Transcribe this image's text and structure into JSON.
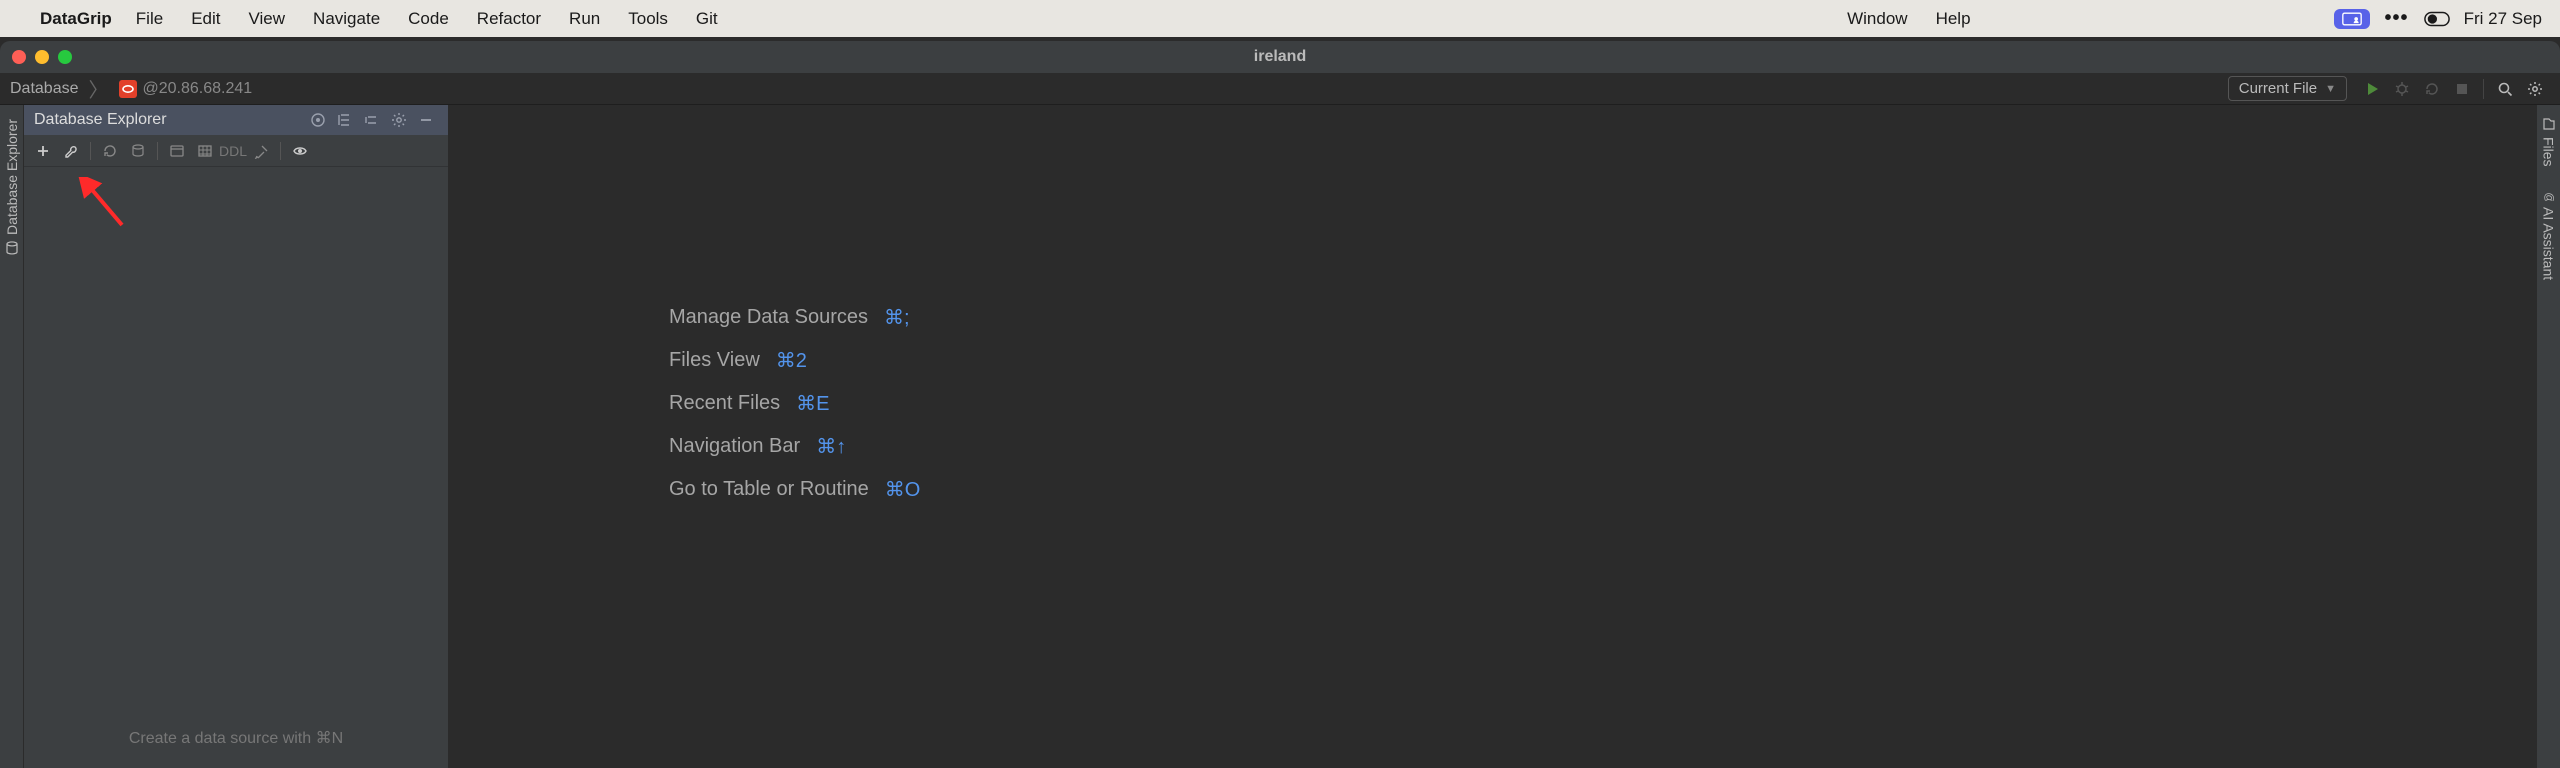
{
  "mac_menu": {
    "app_name": "DataGrip",
    "items": [
      "File",
      "Edit",
      "View",
      "Navigate",
      "Code",
      "Refactor",
      "Run",
      "Tools",
      "Git"
    ],
    "right_items": [
      "Window",
      "Help"
    ],
    "date": "Fri 27 Sep"
  },
  "window": {
    "title": "ireland"
  },
  "breadcrumb": {
    "root": "Database",
    "datasource": "@20.86.68.241"
  },
  "run_config": {
    "label": "Current File"
  },
  "sidebar": {
    "title": "Database Explorer",
    "hint": "Create a data source with ⌘N",
    "toolbar": {
      "ddl": "DDL"
    }
  },
  "left_rail": {
    "tab": "Database Explorer"
  },
  "right_rail": {
    "tab1": "Files",
    "tab2": "AI Assistant"
  },
  "welcome": {
    "rows": [
      {
        "label": "Manage Data Sources",
        "shortcut": "⌘;"
      },
      {
        "label": "Files View",
        "shortcut": "⌘2"
      },
      {
        "label": "Recent Files",
        "shortcut": "⌘E"
      },
      {
        "label": "Navigation Bar",
        "shortcut": "⌘↑"
      },
      {
        "label": "Go to Table or Routine",
        "shortcut": "⌘O"
      }
    ]
  }
}
